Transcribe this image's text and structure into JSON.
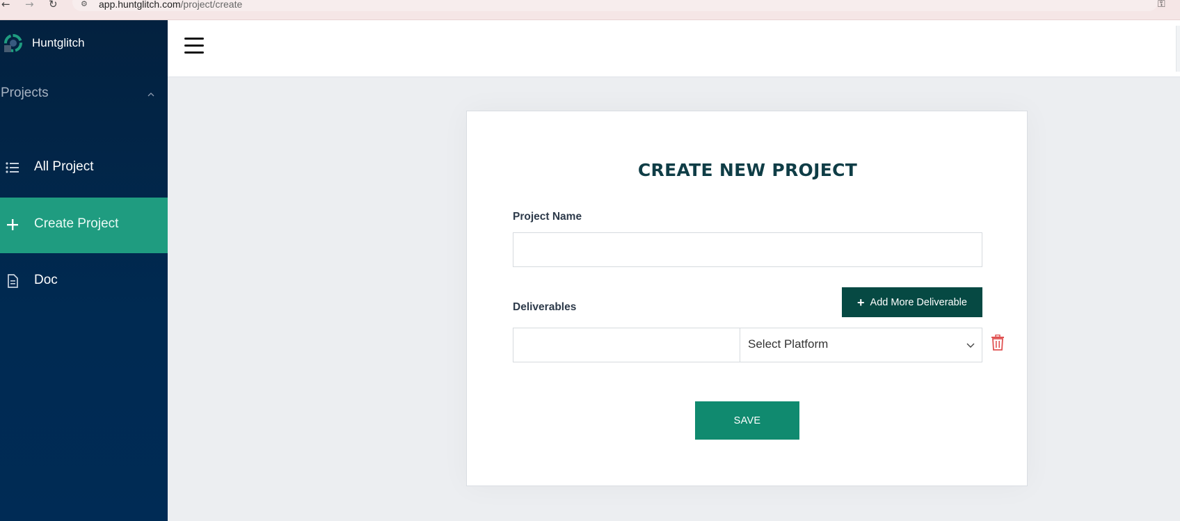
{
  "browser": {
    "url_host": "app.huntglitch.com",
    "url_path": "/project/create"
  },
  "sidebar": {
    "brand_name": "Huntglitch",
    "section_title": "Projects",
    "items": [
      {
        "label": "All Project",
        "icon": "list-icon",
        "active": false
      },
      {
        "label": "Create Project",
        "icon": "plus-icon",
        "active": true
      },
      {
        "label": "Doc",
        "icon": "document-icon",
        "active": false
      }
    ]
  },
  "form": {
    "title": "CREATE NEW PROJECT",
    "project_name_label": "Project Name",
    "project_name_value": "",
    "deliverables_label": "Deliverables",
    "add_more_label": "Add More Deliverable",
    "deliverable_value": "",
    "platform_selected": "Select Platform",
    "save_label": "SAVE"
  },
  "colors": {
    "sidebar_bg": "#002a52",
    "active_item": "#1f9c80",
    "title_text": "#0f3d46",
    "add_button": "#064943",
    "save_button": "#108a6f",
    "trash": "#e05252"
  }
}
